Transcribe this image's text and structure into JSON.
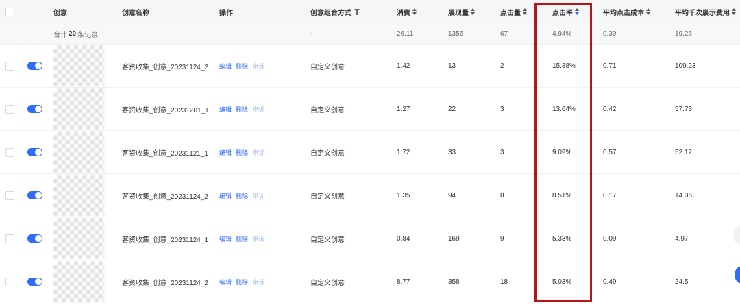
{
  "columns": {
    "creative": "创意",
    "name": "创意名称",
    "operations": "操作",
    "method": "创意组合方式",
    "cost": "消费",
    "impressions": "展现量",
    "clicks": "点击量",
    "ctr": "点击率",
    "cpc": "平均点击成本",
    "cpm": "平均千次展示费用"
  },
  "summary": {
    "prefix": "合计",
    "count": "20",
    "suffix": "条记录",
    "method": "-",
    "cost": "26.11",
    "impressions": "1356",
    "clicks": "67",
    "ctr": "4.94%",
    "cpc": "0.39",
    "cpm": "19.26"
  },
  "ops": {
    "edit": "编辑",
    "delete": "删除",
    "appeal": "申诉"
  },
  "rows": [
    {
      "name": "客资收集_创意_20231124_2",
      "method": "自定义创意",
      "cost": "1.42",
      "impressions": "13",
      "clicks": "2",
      "ctr": "15.38%",
      "cpc": "0.71",
      "cpm": "109.23"
    },
    {
      "name": "客资收集_创意_20231201_1",
      "method": "自定义创意",
      "cost": "1.27",
      "impressions": "22",
      "clicks": "3",
      "ctr": "13.64%",
      "cpc": "0.42",
      "cpm": "57.73"
    },
    {
      "name": "客资收集_创意_20231121_1",
      "method": "自定义创意",
      "cost": "1.72",
      "impressions": "33",
      "clicks": "3",
      "ctr": "9.09%",
      "cpc": "0.57",
      "cpm": "52.12"
    },
    {
      "name": "客资收集_创意_20231124_2",
      "method": "自定义创意",
      "cost": "1.35",
      "impressions": "94",
      "clicks": "8",
      "ctr": "8.51%",
      "cpc": "0.17",
      "cpm": "14.36"
    },
    {
      "name": "客资收集_创意_20231124_1",
      "method": "自定义创意",
      "cost": "0.84",
      "impressions": "169",
      "clicks": "9",
      "ctr": "5.33%",
      "cpc": "0.09",
      "cpm": "4.97"
    },
    {
      "name": "客资收集_创意_20231124_2",
      "method": "自定义创意",
      "cost": "8.77",
      "impressions": "358",
      "clicks": "18",
      "ctr": "5.03%",
      "cpc": "0.49",
      "cpm": "24.5"
    }
  ],
  "colors": {
    "accent": "#2f6bff",
    "highlight_border": "#b3161b"
  }
}
